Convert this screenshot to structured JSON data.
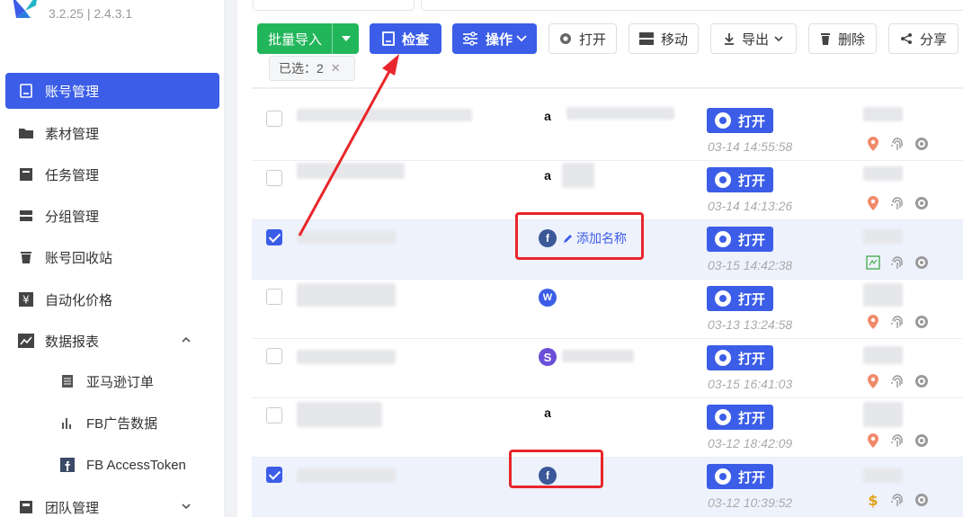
{
  "app": {
    "version": "3.2.25  |  2.4.3.1"
  },
  "sidebar": {
    "items": [
      {
        "label": "账号管理",
        "icon": "account-icon",
        "active": true
      },
      {
        "label": "素材管理",
        "icon": "folder-icon"
      },
      {
        "label": "任务管理",
        "icon": "task-icon"
      },
      {
        "label": "分组管理",
        "icon": "group-icon"
      },
      {
        "label": "账号回收站",
        "icon": "trash-icon"
      },
      {
        "label": "自动化价格",
        "icon": "yen-icon"
      },
      {
        "label": "数据报表",
        "icon": "chart-icon",
        "expanded": true
      },
      {
        "label": "团队管理",
        "icon": "team-icon",
        "expanded": false
      }
    ],
    "sub_items": [
      {
        "label": "亚马逊订单",
        "icon": "document-icon"
      },
      {
        "label": "FB广告数据",
        "icon": "bar-chart-icon"
      },
      {
        "label": "FB AccessToken",
        "icon": "facebook-icon"
      }
    ]
  },
  "toolbar": {
    "import": "批量导入",
    "check": "检查",
    "operate": "操作",
    "open": "打开",
    "move": "移动",
    "export": "导出",
    "delete": "删除",
    "share": "分享"
  },
  "selection": {
    "text": "已选：2"
  },
  "rows": [
    {
      "platform": "a",
      "open": "打开",
      "time": "03-14 14:55:58",
      "checked": false
    },
    {
      "platform": "a",
      "open": "打开",
      "time": "03-14 14:13:26",
      "checked": false
    },
    {
      "platform": "f",
      "open": "打开",
      "time": "03-15 14:42:38",
      "checked": true,
      "add_name": "添加名称"
    },
    {
      "platform": "W",
      "open": "打开",
      "time": "03-13 13:24:58",
      "checked": false
    },
    {
      "platform": "S",
      "open": "打开",
      "time": "03-15 16:41:03",
      "checked": false
    },
    {
      "platform": "a",
      "open": "打开",
      "time": "03-12 18:42:09",
      "checked": false
    },
    {
      "platform": "f",
      "open": "打开",
      "time": "03-12 10:39:52",
      "checked": true
    }
  ],
  "colors": {
    "accent": "#3b5de7",
    "green": "#22b65a",
    "annotation": "#e8262b"
  }
}
